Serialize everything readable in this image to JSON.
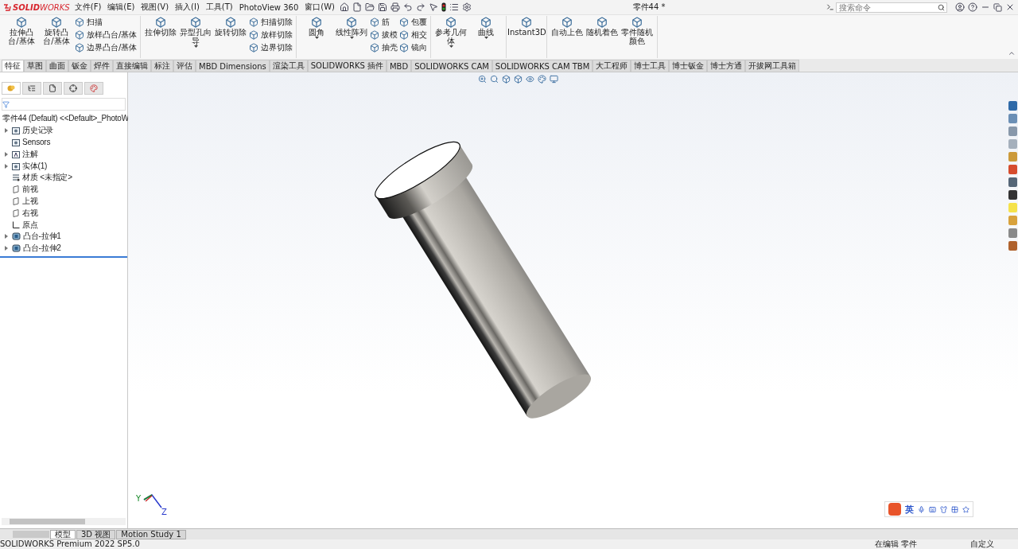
{
  "app": {
    "logo": "**SOLID**WORKS"
  },
  "menu": [
    "文件(F)",
    "编辑(E)",
    "视图(V)",
    "插入(I)",
    "工具(T)",
    "PhotoView 360",
    "窗口(W)"
  ],
  "title": "零件44 *",
  "search": {
    "placeholder": "搜索命令"
  },
  "command_groups": [
    {
      "items": [
        {
          "kind": "large",
          "label": "拉伸凸台/基体",
          "dropdown": false
        },
        {
          "kind": "large",
          "label": "旋转凸台/基体",
          "dropdown": false
        },
        {
          "kind": "stack",
          "labels": [
            "扫描",
            "放样凸台/基体",
            "边界凸台/基体"
          ]
        }
      ]
    },
    {
      "items": [
        {
          "kind": "large",
          "label": "拉伸切除",
          "dropdown": false
        },
        {
          "kind": "large",
          "label": "异型孔向导",
          "dropdown": true
        },
        {
          "kind": "large",
          "label": "旋转切除",
          "dropdown": false
        },
        {
          "kind": "stack",
          "labels": [
            "扫描切除",
            "放样切除",
            "边界切除"
          ]
        }
      ]
    },
    {
      "items": [
        {
          "kind": "large",
          "label": "圆角",
          "dropdown": true
        },
        {
          "kind": "large",
          "label": "线性阵列",
          "dropdown": true
        },
        {
          "kind": "stack",
          "labels": [
            "筋",
            "拔模",
            "抽壳"
          ]
        },
        {
          "kind": "stack",
          "labels": [
            "包覆",
            "相交",
            "镜向"
          ]
        }
      ]
    },
    {
      "items": [
        {
          "kind": "large",
          "label": "参考几何体",
          "dropdown": true
        },
        {
          "kind": "large",
          "label": "曲线",
          "dropdown": true
        }
      ]
    },
    {
      "items": [
        {
          "kind": "large",
          "label": "Instant3D",
          "dropdown": false
        }
      ]
    },
    {
      "items": [
        {
          "kind": "large",
          "label": "自动上色",
          "dropdown": false
        },
        {
          "kind": "large",
          "label": "随机着色",
          "dropdown": false
        },
        {
          "kind": "large",
          "label": "零件随机颜色",
          "dropdown": false
        }
      ]
    }
  ],
  "tabs": [
    {
      "label": "特征",
      "selected": true
    },
    {
      "label": "草图",
      "selected": false
    },
    {
      "label": "曲面",
      "selected": false
    },
    {
      "label": "钣金",
      "selected": false
    },
    {
      "label": "焊件",
      "selected": false
    },
    {
      "label": "直接编辑",
      "selected": false
    },
    {
      "label": "标注",
      "selected": false
    },
    {
      "label": "评估",
      "selected": false
    },
    {
      "label": "MBD Dimensions",
      "selected": false
    },
    {
      "label": "渲染工具",
      "selected": false
    },
    {
      "label": "SOLIDWORKS 插件",
      "selected": false
    },
    {
      "label": "MBD",
      "selected": false
    },
    {
      "label": "SOLIDWORKS CAM",
      "selected": false
    },
    {
      "label": "SOLIDWORKS CAM TBM",
      "selected": false
    },
    {
      "label": "大工程师",
      "selected": false
    },
    {
      "label": "博士工具",
      "selected": false
    },
    {
      "label": "博士钣金",
      "selected": false
    },
    {
      "label": "博士方通",
      "selected": false
    },
    {
      "label": "开拔网工具箱",
      "selected": false
    }
  ],
  "tree": {
    "root": "零件44 (Default) <<Default>_PhotoW",
    "items": [
      {
        "label": "历史记录",
        "kind": "folder",
        "expandable": true
      },
      {
        "label": "Sensors",
        "kind": "folder",
        "expandable": false
      },
      {
        "label": "注解",
        "kind": "annotation",
        "expandable": true
      },
      {
        "label": "实体(1)",
        "kind": "folder",
        "expandable": true
      },
      {
        "label": "材质 <未指定>",
        "kind": "material",
        "expandable": false
      },
      {
        "label": "前视",
        "kind": "plane",
        "expandable": false
      },
      {
        "label": "上视",
        "kind": "plane",
        "expandable": false
      },
      {
        "label": "右视",
        "kind": "plane",
        "expandable": false
      },
      {
        "label": "原点",
        "kind": "origin",
        "expandable": false
      },
      {
        "label": "凸台-拉伸1",
        "kind": "feature",
        "expandable": true
      },
      {
        "label": "凸台-拉伸2",
        "kind": "feature",
        "expandable": true
      }
    ]
  },
  "triad": {
    "labels": [
      "Y",
      "Z"
    ]
  },
  "ime": {
    "language": "英"
  },
  "bottom_tabs": [
    {
      "label": "模型",
      "selected": true
    },
    {
      "label": "3D 视图",
      "selected": false
    },
    {
      "label": "Motion Study 1",
      "selected": false
    }
  ],
  "status": {
    "product": "SOLIDWORKS Premium 2022 SP5.0",
    "mode": "在编辑 零件",
    "units": "自定义"
  }
}
